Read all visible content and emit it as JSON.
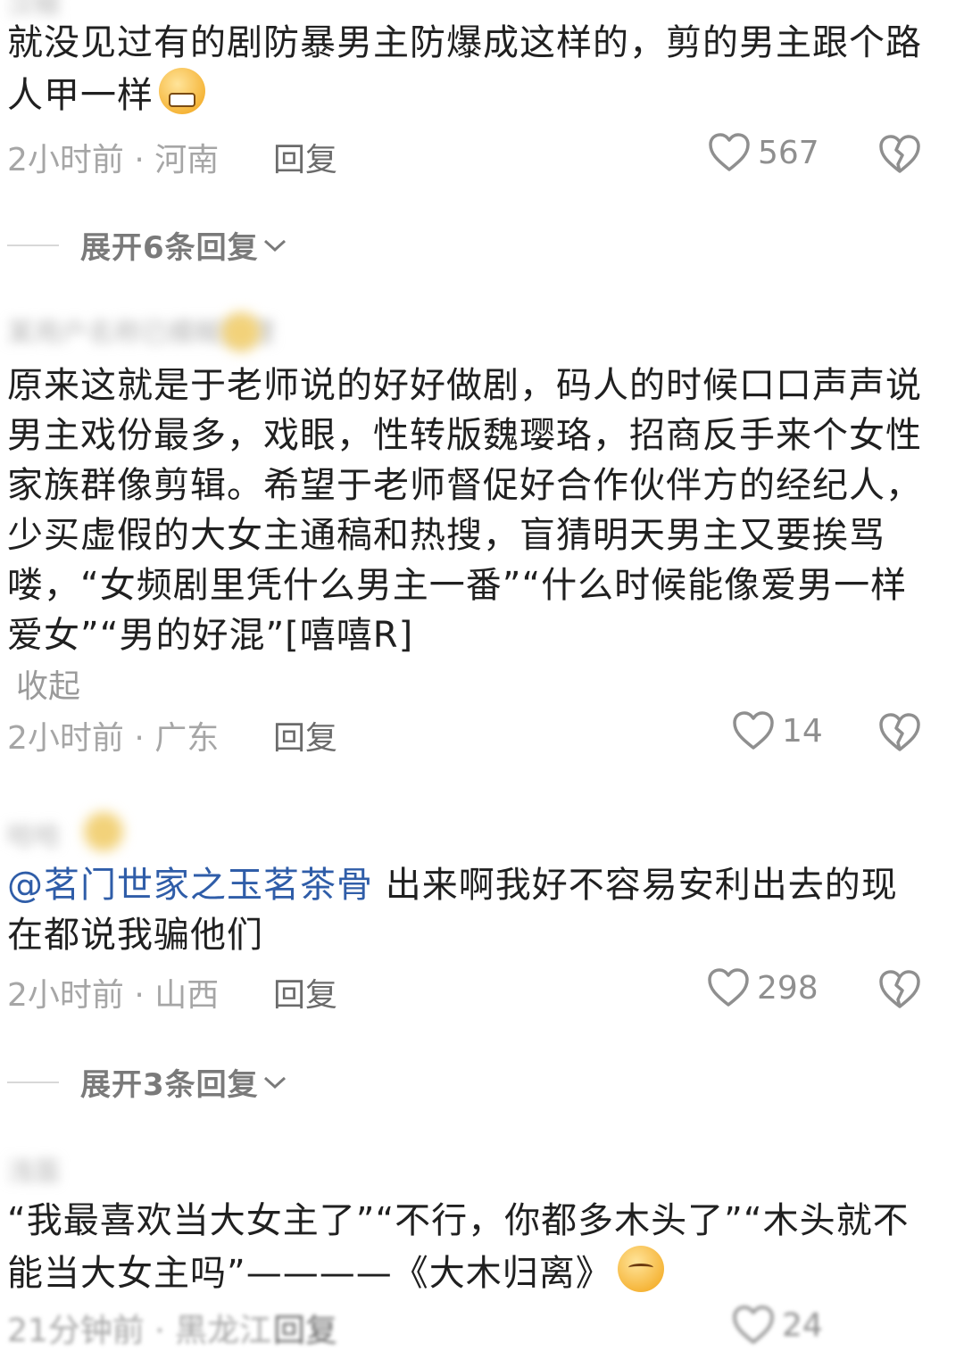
{
  "comments": [
    {
      "username": "汉椒",
      "body": "就没见过有的剧防暴男主防爆成这样的，剪的男主跟个路人甲一样",
      "time_location": "2小时前 · 河南",
      "reply_label": "回复",
      "likes": "567",
      "replies_expand": "展开6条回复"
    },
    {
      "username": "某用户名称已模糊处理",
      "body": "原来这就是于老师说的好好做剧，码人的时候口口声声说男主戏份最多，戏眼，性转版魏璎珞，招商反手来个女性家族群像剪辑。希望于老师督促好合作伙伴方的经纪人，少买虚假的大女主通稿和热搜，盲猜明天男主又要挨骂喽，“女频剧里凭什么男主一番”“什么时候能像爱男一样爱女”“男的好混”[嘻嘻R]",
      "collapse_label": "收起",
      "time_location": "2小时前 · 广东",
      "reply_label": "回复",
      "likes": "14"
    },
    {
      "username": "哈哈",
      "mention": "@茗门世家之玉茗茶骨",
      "body": " 出来啊我好不容易安利出去的现在都说我骗他们",
      "time_location": "2小时前 · 山西",
      "reply_label": "回复",
      "likes": "298",
      "replies_expand": "展开3条回复"
    },
    {
      "username": "浅笛",
      "body": "“我最喜欢当大女主了”“不行，你都多木头了”“木头就不能当大女主吗”————《大木归离》",
      "time_location": "21分钟前 · 黑龙江",
      "reply_label": "回复",
      "likes": "24"
    }
  ],
  "icons": {
    "like": "heart-outline-icon",
    "dislike": "broken-heart-icon",
    "expand": "chevron-down-icon"
  },
  "colors": {
    "mention": "#2f5da8",
    "meta": "#a6a6a6",
    "text": "#202020"
  }
}
